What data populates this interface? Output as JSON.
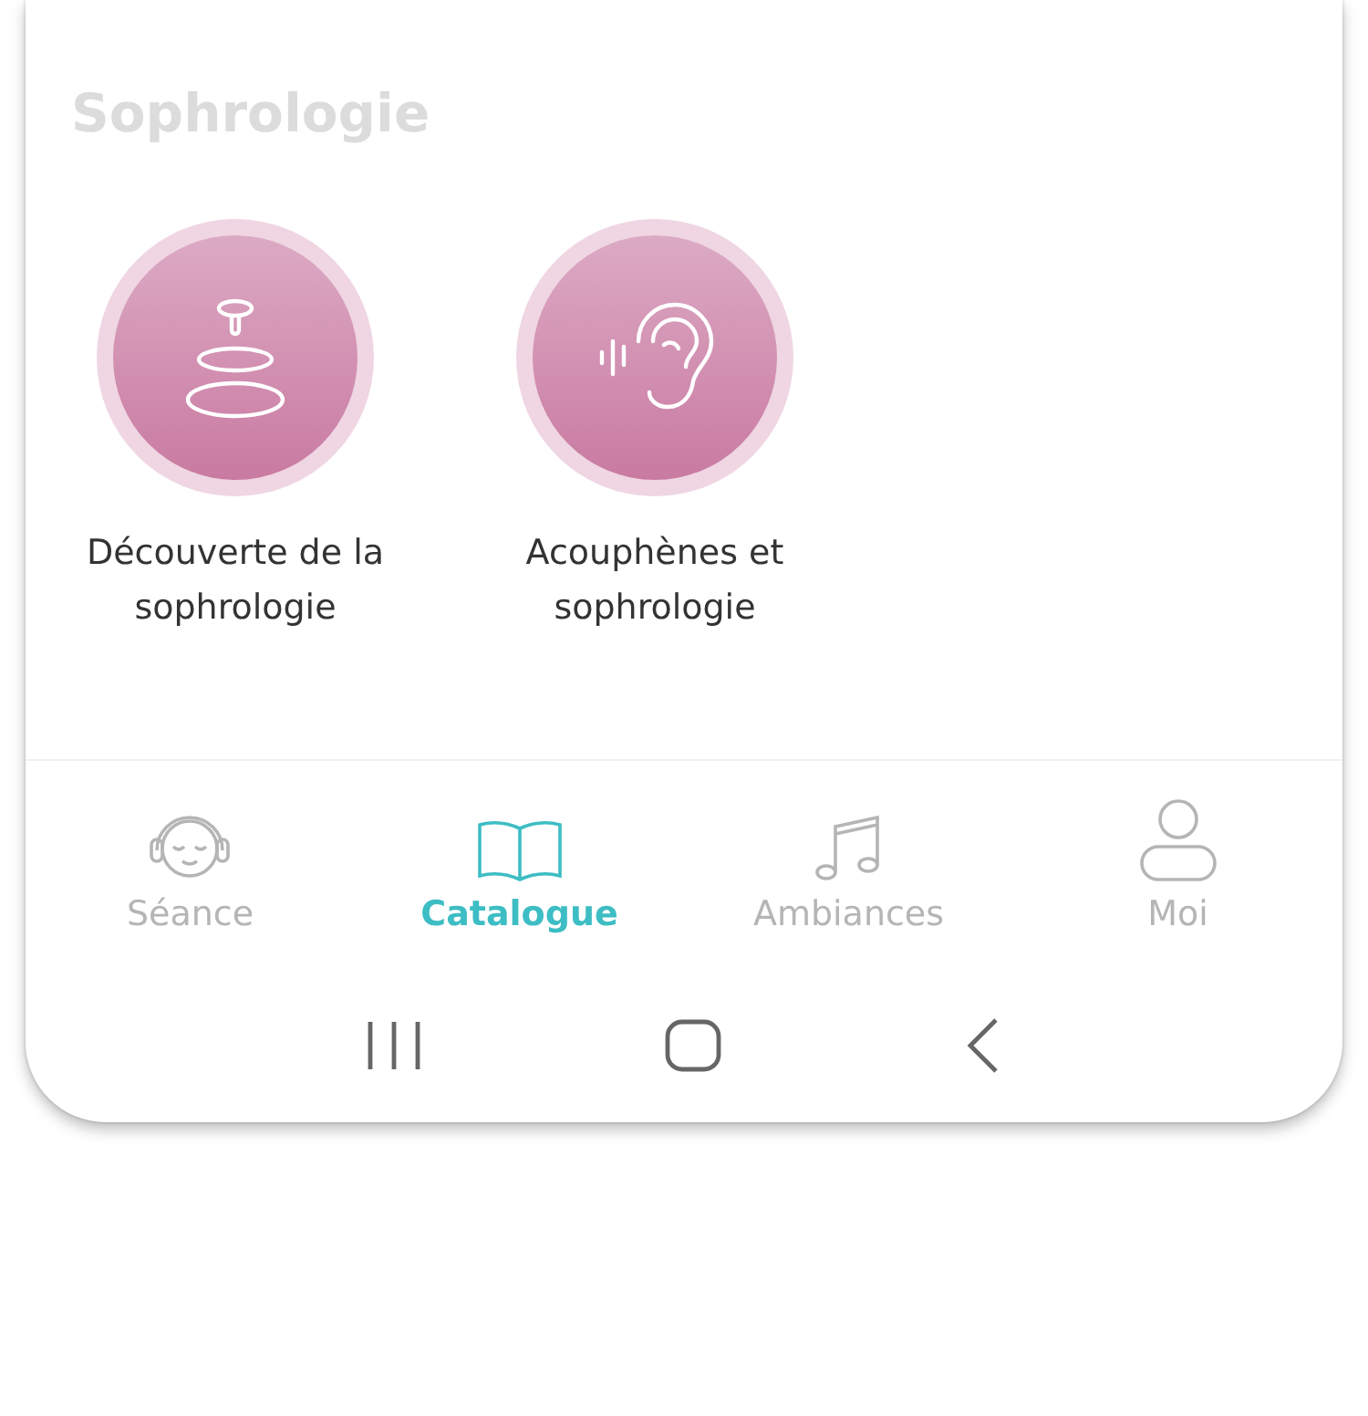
{
  "section_title": "Sophrologie",
  "programs": [
    {
      "label": "Découverte de la sophrologie"
    },
    {
      "label": "Acouphènes et sophrologie"
    }
  ],
  "tabs": [
    {
      "label": "Séance",
      "selected": false
    },
    {
      "label": "Catalogue",
      "selected": true
    },
    {
      "label": "Ambiances",
      "selected": false
    },
    {
      "label": "Moi",
      "selected": false
    }
  ]
}
